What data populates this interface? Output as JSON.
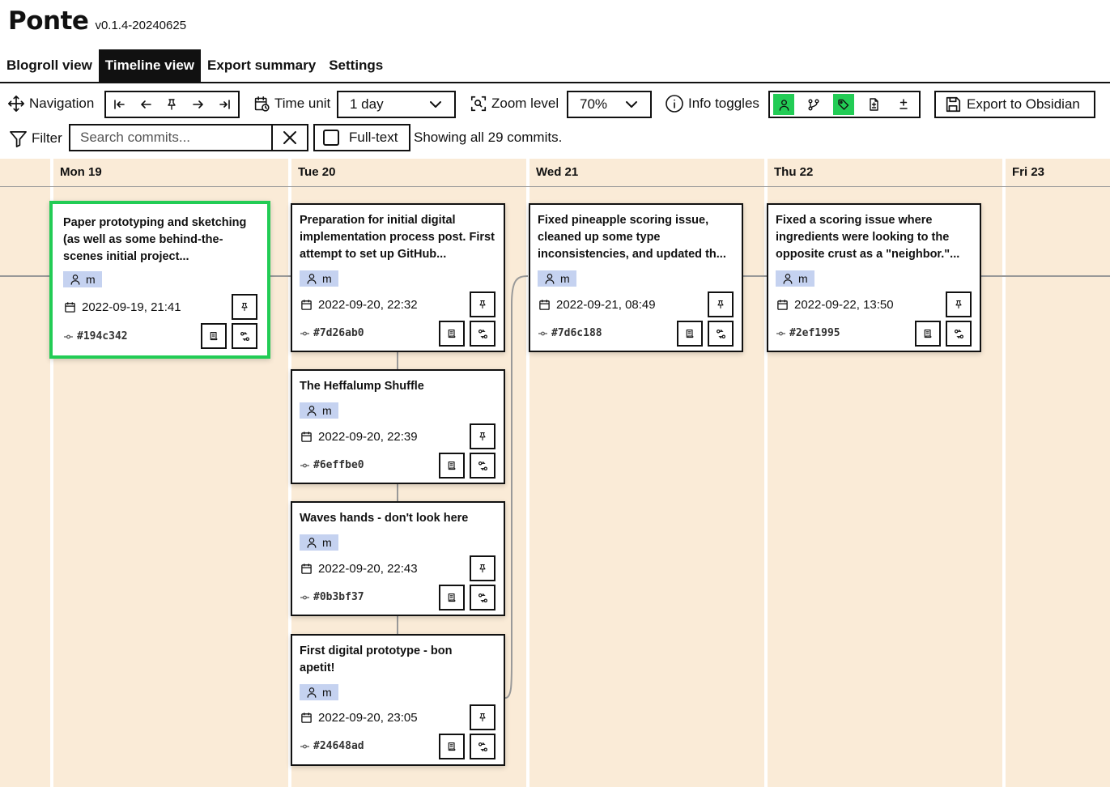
{
  "app": {
    "title": "Ponte",
    "version": "v0.1.4-20240625"
  },
  "tabs": [
    {
      "label": "Blogroll view",
      "active": false
    },
    {
      "label": "Timeline view",
      "active": true
    },
    {
      "label": "Export summary",
      "active": false
    },
    {
      "label": "Settings",
      "active": false
    }
  ],
  "toolbar": {
    "navigation_label": "Navigation",
    "nav_buttons": [
      "first-icon",
      "prev-icon",
      "pin-icon",
      "next-icon",
      "last-icon"
    ],
    "time_unit_label": "Time unit",
    "time_unit_value": "1 day",
    "zoom_label": "Zoom level",
    "zoom_value": "70%",
    "info_toggles_label": "Info toggles",
    "info_toggles": [
      {
        "icon": "author-icon",
        "on": true
      },
      {
        "icon": "branch-icon",
        "on": false
      },
      {
        "icon": "tag-icon",
        "on": true
      },
      {
        "icon": "file-diff-icon",
        "on": false
      },
      {
        "icon": "plus-minus-icon",
        "on": false
      }
    ],
    "export_label": "Export to Obsidian"
  },
  "filter": {
    "label": "Filter",
    "placeholder": "Search commits...",
    "fulltext_label": "Full-text",
    "status": "Showing all 29 commits."
  },
  "colors": {
    "accent_green": "#22cc55",
    "author_chip": "#c5d2f0",
    "timeline_bg": "#faebd7"
  },
  "days": [
    "Mon 19",
    "Tue 20",
    "Wed 21",
    "Thu 22",
    "Fri 23"
  ],
  "commits": [
    {
      "message": "Paper prototyping and sketching (as well as some behind-the-scenes initial project...",
      "author": "m",
      "date": "2022-09-19, 21:41",
      "hash": "#194c342",
      "selected": true
    },
    {
      "message": "Preparation for initial digital implementation process post. First attempt to set up GitHub...",
      "author": "m",
      "date": "2022-09-20, 22:32",
      "hash": "#7d26ab0",
      "selected": false
    },
    {
      "message": "The Heffalump Shuffle",
      "author": "m",
      "date": "2022-09-20, 22:39",
      "hash": "#6effbe0",
      "selected": false
    },
    {
      "message": "Waves hands - don't look here",
      "author": "m",
      "date": "2022-09-20, 22:43",
      "hash": "#0b3bf37",
      "selected": false
    },
    {
      "message": "First digital prototype - bon apetit!",
      "author": "m",
      "date": "2022-09-20, 23:05",
      "hash": "#24648ad",
      "selected": false
    },
    {
      "message": "Fixed pineapple scoring issue, cleaned up some type inconsistencies, and updated th...",
      "author": "m",
      "date": "2022-09-21, 08:49",
      "hash": "#7d6c188",
      "selected": false
    },
    {
      "message": "Fixed a scoring issue where ingredients were looking to the opposite crust as a \"neighbor.\"...",
      "author": "m",
      "date": "2022-09-22, 13:50",
      "hash": "#2ef1995",
      "selected": false
    }
  ]
}
